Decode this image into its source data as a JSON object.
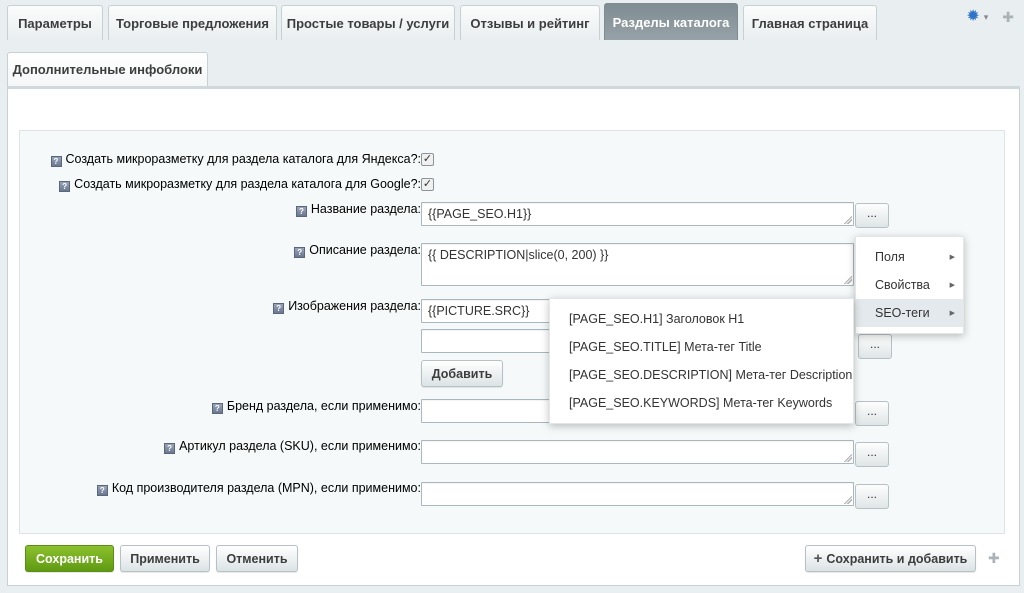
{
  "tabs": [
    {
      "label": "Параметры"
    },
    {
      "label": "Торговые предложения"
    },
    {
      "label": "Простые товары / услуги"
    },
    {
      "label": "Отзывы и рейтинг"
    },
    {
      "label": "Разделы каталога"
    },
    {
      "label": "Главная страница"
    }
  ],
  "tabs2": [
    {
      "label": "Дополнительные инфоблоки"
    }
  ],
  "icons": {
    "settings": "gear-icon",
    "pin": "pin-icon",
    "hint": "help-icon"
  },
  "form": {
    "yandex_label": "Создать микроразметку для раздела каталога для Яндекса?:",
    "google_label": "Создать микроразметку для раздела каталога для Google?:",
    "name_label": "Название раздела:",
    "name_value": "{{PAGE_SEO.H1}}",
    "desc_label": "Описание раздела:",
    "desc_value": "{{ DESCRIPTION|slice(0, 200) }}",
    "images_label": "Изображения раздела:",
    "images_value": "{{PICTURE.SRC}}",
    "add_label": "Добавить",
    "brand_label": "Бренд раздела, если применимо:",
    "sku_label": "Артикул раздела (SKU), если применимо:",
    "mpn_label": "Код производителя раздела (MPN), если применимо:",
    "dots": "..."
  },
  "menu1": {
    "items": [
      {
        "label": "Поля"
      },
      {
        "label": "Свойства"
      },
      {
        "label": "SEO-теги"
      }
    ]
  },
  "menu2": {
    "items": [
      {
        "label": "[PAGE_SEO.H1] Заголовок H1"
      },
      {
        "label": "[PAGE_SEO.TITLE] Мета-тег Title"
      },
      {
        "label": "[PAGE_SEO.DESCRIPTION] Мета-тег Description"
      },
      {
        "label": "[PAGE_SEO.KEYWORDS] Мета-тег Keywords"
      }
    ]
  },
  "footer": {
    "save": "Сохранить",
    "apply": "Применить",
    "cancel": "Отменить",
    "save_add": "Сохранить и добавить"
  },
  "colors": {
    "active_tab": "#8a979d",
    "save_button": "#72ad1c",
    "gear": "#2f74c6"
  }
}
